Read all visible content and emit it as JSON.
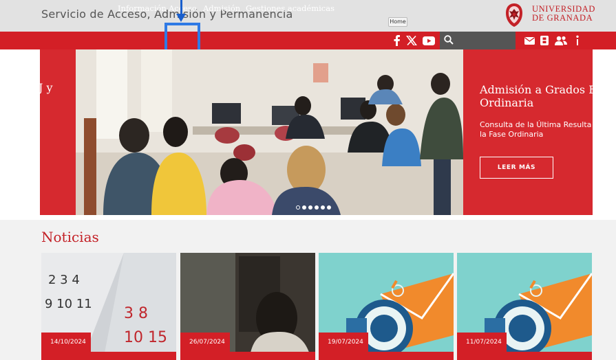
{
  "header": {
    "site_title": "Servicio de Acceso, Admisión y Permanencia",
    "tooltip": "Home",
    "university_line1": "UNIVERSIDAD",
    "university_line2": "DE GRANADA"
  },
  "nav": {
    "items": [
      "Información",
      "Acceso",
      "Admisión",
      "Gestiones académicas"
    ],
    "highlighted": "Acceso"
  },
  "social": {
    "icons": [
      "facebook-icon",
      "x-icon",
      "youtube-icon"
    ]
  },
  "toolbar": {
    "icons": [
      "search-icon",
      "mail-icon",
      "contact-card-icon",
      "users-icon",
      "info-icon"
    ]
  },
  "hero": {
    "left_fragment": "J y",
    "title_line1": "Admisión a Grados F",
    "title_line2": "Ordinaria",
    "subtitle_line1": "Consulta de la Última Resulta",
    "subtitle_line2": "la Fase Ordinaria",
    "cta_label": "LEER MÁS",
    "slide_count": 6,
    "active_slide": 1
  },
  "news": {
    "title": "Noticias",
    "cards": [
      {
        "date": "14/10/2024"
      },
      {
        "date": "26/07/2024"
      },
      {
        "date": "19/07/2024"
      },
      {
        "date": "11/07/2024"
      }
    ]
  },
  "colors": {
    "brand_red": "#d31f26",
    "annotation_blue": "#2f7ae5"
  }
}
